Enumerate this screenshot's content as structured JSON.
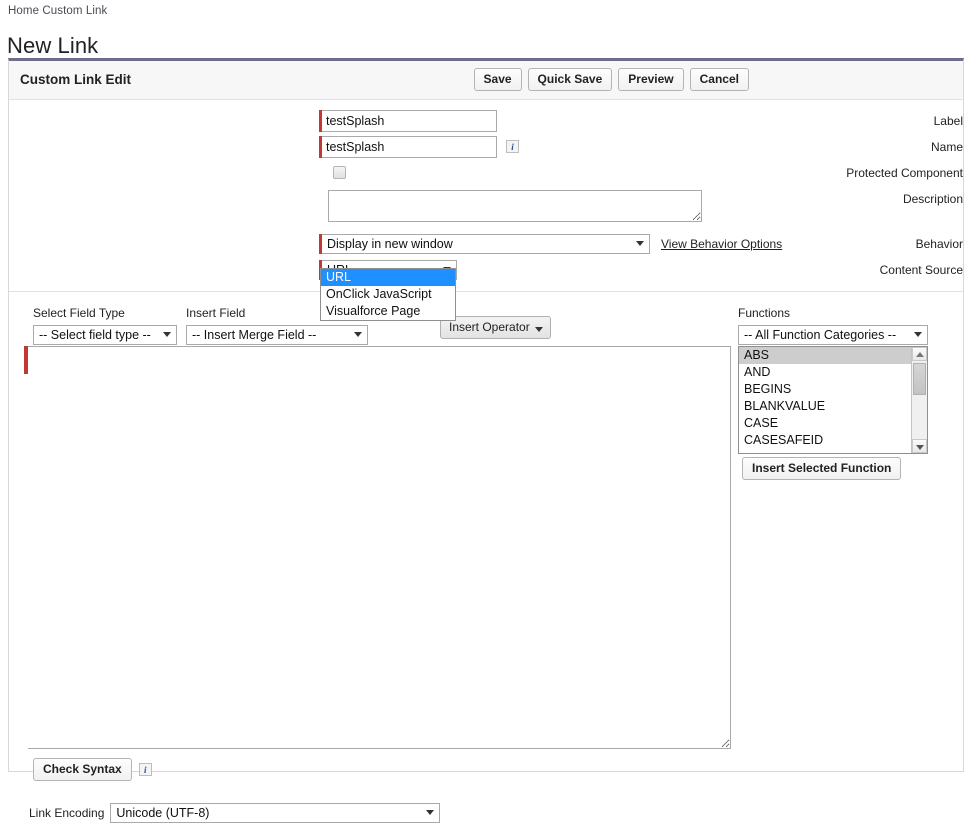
{
  "breadcrumb": "Home Custom Link",
  "page_title": "New Link",
  "panel": {
    "title": "Custom Link Edit",
    "buttons": [
      {
        "label": "Save",
        "name": "save-button"
      },
      {
        "label": "Quick Save",
        "name": "quick-save-button"
      },
      {
        "label": "Preview",
        "name": "preview-button"
      },
      {
        "label": "Cancel",
        "name": "cancel-button"
      }
    ]
  },
  "form": {
    "label_field": {
      "label": "Label",
      "value": "testSplash",
      "required": true
    },
    "name_field": {
      "label": "Name",
      "value": "testSplash",
      "required": true,
      "info": "i"
    },
    "protected_component": {
      "label": "Protected Component",
      "checked": false
    },
    "description": {
      "label": "Description",
      "value": ""
    },
    "behavior": {
      "label": "Behavior",
      "value": "Display in new window",
      "required": true,
      "link_text": "View Behavior Options"
    },
    "content_source": {
      "label": "Content Source",
      "value": "URL",
      "required": true,
      "open": true,
      "options": [
        "URL",
        "OnClick JavaScript",
        "Visualforce Page"
      ],
      "selected_option": "URL"
    }
  },
  "editor": {
    "select_field_type": {
      "label": "Select Field Type",
      "value": "-- Select field type --"
    },
    "insert_field": {
      "label": "Insert Field",
      "value": "-- Insert Merge Field --"
    },
    "insert_operator": {
      "label": "Insert Operator"
    },
    "formula_value": "",
    "functions": {
      "label": "Functions",
      "category_value": "-- All Function Categories --",
      "items": [
        "ABS",
        "AND",
        "BEGINS",
        "BLANKVALUE",
        "CASE",
        "CASESAFEID"
      ],
      "selected_item": "ABS",
      "insert_button": "Insert Selected Function"
    },
    "check_syntax": {
      "label": "Check Syntax",
      "info": "i"
    }
  },
  "footer": {
    "link_encoding_label": "Link Encoding",
    "link_encoding_value": "Unicode (UTF-8)"
  }
}
